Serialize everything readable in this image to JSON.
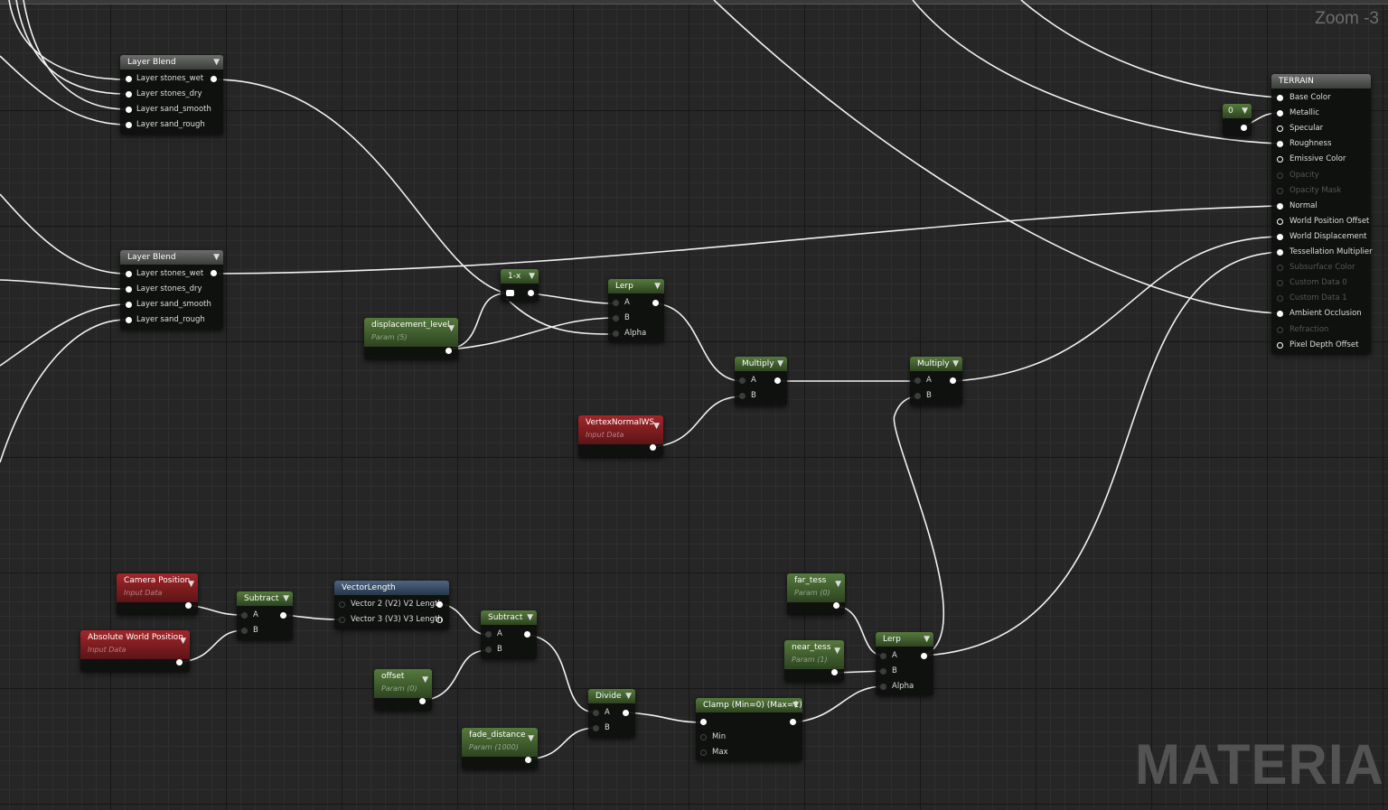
{
  "header": {
    "zoom": "Zoom -3"
  },
  "watermark": "MATERIAL",
  "nodes": {
    "layer_blend_1": {
      "title": "Layer Blend",
      "inputs": [
        "Layer stones_wet",
        "Layer stones_dry",
        "Layer sand_smooth",
        "Layer sand_rough"
      ]
    },
    "layer_blend_2": {
      "title": "Layer Blend",
      "inputs": [
        "Layer stones_wet",
        "Layer stones_dry",
        "Layer sand_smooth",
        "Layer sand_rough"
      ]
    },
    "constant_zero": {
      "title": "0"
    },
    "one_minus": {
      "title": "1-x"
    },
    "displacement_level": {
      "title": "displacement_level",
      "sub": "Param (5)"
    },
    "lerp_top": {
      "title": "Lerp",
      "inputs": [
        "A",
        "B",
        "Alpha"
      ]
    },
    "multiply_1": {
      "title": "Multiply",
      "inputs": [
        "A",
        "B"
      ]
    },
    "multiply_2": {
      "title": "Multiply",
      "inputs": [
        "A",
        "B"
      ]
    },
    "vertex_normal": {
      "title": "VertexNormalWS",
      "sub": "Input Data"
    },
    "camera_position": {
      "title": "Camera Position",
      "sub": "Input Data"
    },
    "absolute_world_position": {
      "title": "Absolute World Position",
      "sub": "Input Data"
    },
    "subtract_1": {
      "title": "Subtract",
      "inputs": [
        "A",
        "B"
      ]
    },
    "vector_length": {
      "title": "VectorLength",
      "inputs": [
        "Vector 2 (V2) V2 Length",
        "Vector 3 (V3) V3 Length"
      ]
    },
    "subtract_2": {
      "title": "Subtract",
      "inputs": [
        "A",
        "B"
      ]
    },
    "offset": {
      "title": "offset",
      "sub": "Param (0)"
    },
    "divide": {
      "title": "Divide",
      "inputs": [
        "A",
        "B"
      ]
    },
    "fade_distance": {
      "title": "fade_distance",
      "sub": "Param (1000)"
    },
    "clamp": {
      "title": "Clamp (Min=0) (Max=1)",
      "inputs": [
        "",
        "Min",
        "Max"
      ]
    },
    "far_tess": {
      "title": "far_tess",
      "sub": "Param (0)"
    },
    "near_tess": {
      "title": "near_tess",
      "sub": "Param (1)"
    },
    "lerp_bottom": {
      "title": "Lerp",
      "inputs": [
        "A",
        "B",
        "Alpha"
      ]
    }
  },
  "terrain": {
    "title": "TERRAIN",
    "pins": [
      {
        "label": "Base Color",
        "state": "connected"
      },
      {
        "label": "Metallic",
        "state": "connected"
      },
      {
        "label": "Specular",
        "state": "open"
      },
      {
        "label": "Roughness",
        "state": "connected"
      },
      {
        "label": "Emissive Color",
        "state": "open"
      },
      {
        "label": "Opacity",
        "state": "disabled"
      },
      {
        "label": "Opacity Mask",
        "state": "disabled"
      },
      {
        "label": "Normal",
        "state": "connected"
      },
      {
        "label": "World Position Offset",
        "state": "open"
      },
      {
        "label": "World Displacement",
        "state": "connected"
      },
      {
        "label": "Tessellation Multiplier",
        "state": "connected"
      },
      {
        "label": "Subsurface Color",
        "state": "disabled"
      },
      {
        "label": "Custom Data 0",
        "state": "disabled"
      },
      {
        "label": "Custom Data 1",
        "state": "disabled"
      },
      {
        "label": "Ambient Occlusion",
        "state": "connected"
      },
      {
        "label": "Refraction",
        "state": "disabled"
      },
      {
        "label": "Pixel Depth Offset",
        "state": "open"
      }
    ]
  }
}
